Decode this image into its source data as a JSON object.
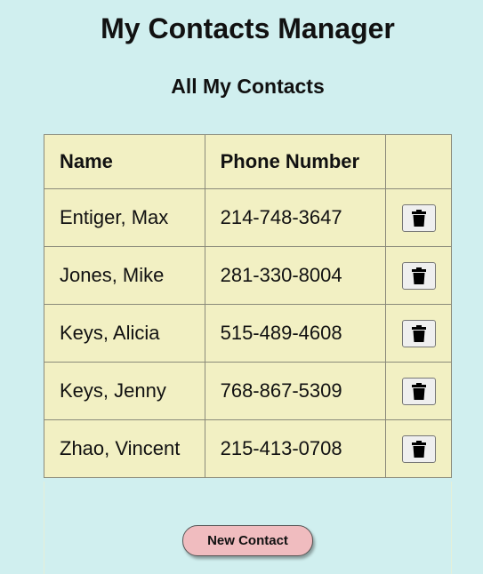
{
  "header": {
    "title": "My Contacts Manager",
    "subtitle": "All My Contacts"
  },
  "table": {
    "columns": [
      "Name",
      "Phone Number",
      ""
    ],
    "rows": [
      {
        "name": "Entiger, Max",
        "phone": "214-748-3647"
      },
      {
        "name": "Jones, Mike",
        "phone": "281-330-8004"
      },
      {
        "name": "Keys, Alicia",
        "phone": "515-489-4608"
      },
      {
        "name": "Keys, Jenny",
        "phone": "768-867-5309"
      },
      {
        "name": "Zhao, Vincent",
        "phone": "215-413-0708"
      }
    ],
    "delete_icon": "trash-icon"
  },
  "actions": {
    "new_contact_label": "New Contact"
  },
  "colors": {
    "background": "#d0efef",
    "table_background": "#f2f0c3",
    "new_button": "#f0bcbf"
  }
}
